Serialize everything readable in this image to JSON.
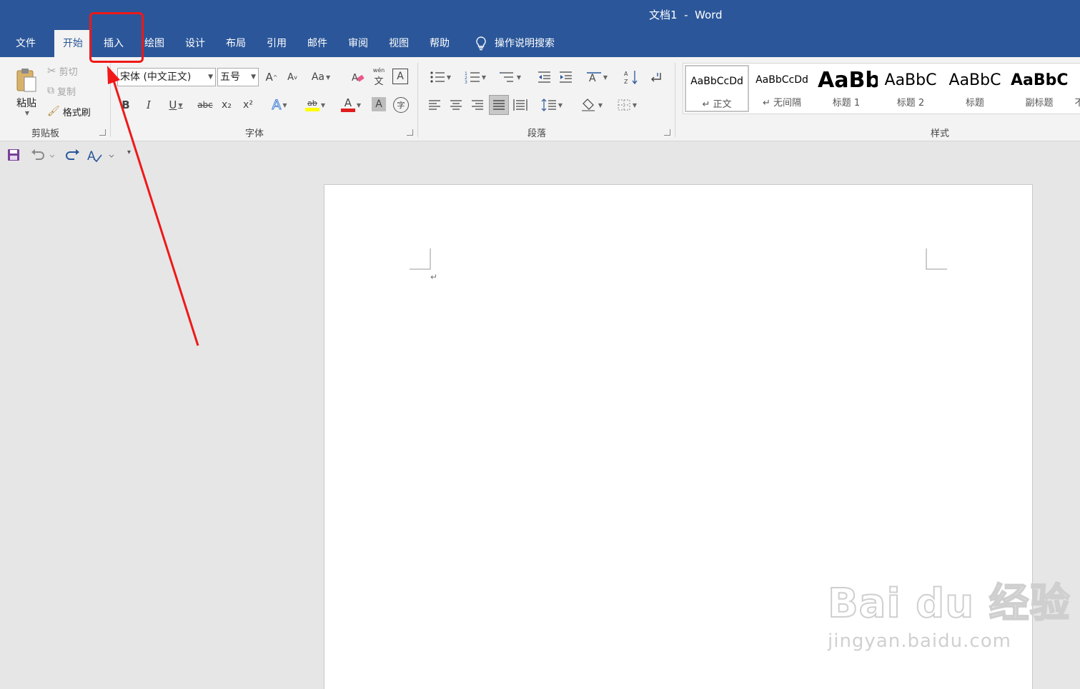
{
  "window": {
    "title": "文档1  -  Word"
  },
  "tabs": [
    {
      "label": "文件"
    },
    {
      "label": "开始"
    },
    {
      "label": "插入"
    },
    {
      "label": "绘图"
    },
    {
      "label": "设计"
    },
    {
      "label": "布局"
    },
    {
      "label": "引用"
    },
    {
      "label": "邮件"
    },
    {
      "label": "审阅"
    },
    {
      "label": "视图"
    },
    {
      "label": "帮助"
    }
  ],
  "search": {
    "label": "操作说明搜索"
  },
  "clipboard": {
    "paste_label": "粘贴",
    "cut_label": "剪切",
    "copy_label": "复制",
    "format_painter_label": "格式刷",
    "group_label": "剪贴板"
  },
  "font": {
    "name": "宋体 (中文正文)",
    "size": "五号",
    "group_label": "字体",
    "change_case_label": "Aa",
    "phonetic_label": "wén",
    "strike_label": "abc",
    "bold_label": "B",
    "italic_label": "I",
    "underline_label": "U",
    "sub_label": "x₂",
    "sup_label": "x²",
    "grow_label": "A",
    "shrink_label": "A",
    "highlight_label": "ab",
    "font_color_label": "A",
    "shade_label": "A",
    "enclose_label": "字"
  },
  "paragraph": {
    "group_label": "段落"
  },
  "styles": {
    "group_label": "样式",
    "items": [
      {
        "sample": "AaBbCcDd",
        "name": "↵ 正文"
      },
      {
        "sample": "AaBbCcDd",
        "name": "↵ 无间隔"
      },
      {
        "sample": "AaBb",
        "name": "标题 1"
      },
      {
        "sample": "AaBbC",
        "name": "标题 2"
      },
      {
        "sample": "AaBbC",
        "name": "标题"
      },
      {
        "sample": "AaBbC",
        "name": "副标题"
      },
      {
        "sample": "",
        "name": "不"
      }
    ]
  },
  "document": {
    "paragraph_mark": "↵"
  },
  "watermark": {
    "logo": "Bai du 经验",
    "url": "jingyan.baidu.com"
  },
  "colors": {
    "accent": "#2b579a",
    "annotation": "#f01818",
    "highlight": "#ffff00",
    "font_color": "#e11c1c"
  }
}
